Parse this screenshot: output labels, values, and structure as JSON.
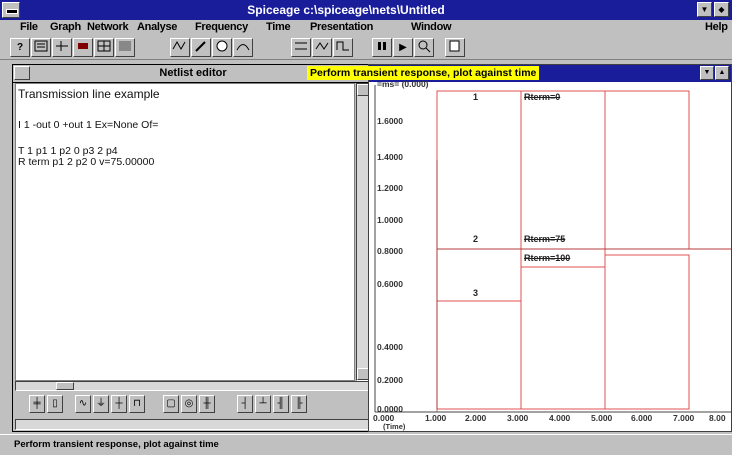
{
  "window": {
    "title": "Spiceage c:\\spiceage\\nets\\Untitled",
    "minimize_glyph": "▼",
    "restore_glyph": "◆"
  },
  "menu": {
    "items": [
      "File",
      "Graph",
      "Network",
      "Analyse",
      "Frequency",
      "Time",
      "Presentation",
      "Window"
    ],
    "help": "Help"
  },
  "toolbar": {
    "buttons": [
      "help-icon",
      "netlist-icon",
      "network-icon",
      "component-icon",
      "grid-icon",
      "table-icon",
      "wave-icon",
      "probe-icon",
      "circle-icon",
      "graph-icon",
      "compare-icon",
      "time-icon",
      "step-icon",
      "run-icon",
      "zoom-icon",
      "export-icon"
    ],
    "help_label": "?",
    "run_label": "▶"
  },
  "netlist": {
    "title": "Netlist editor",
    "lines": [
      "Transmission line example",
      "I  1          -out 0       +out 1      Ex=None    Of=",
      "T  1          p1 1         p2 0        p3 2         p4",
      "R  term       p1 2         p2 0        v=75.00000"
    ],
    "components": [
      "cap-icon",
      "resistor-icon",
      "inductor-icon",
      "ground-icon",
      "diode-icon",
      "source-icon",
      "switch-icon",
      "meter-icon",
      "tline-icon",
      "coupler-icon",
      "probe-icon",
      "port-icon"
    ]
  },
  "plot": {
    "title": "Perform transient response, plot against time",
    "header_label": "=ms= (0.000)",
    "y_ticks": [
      "1.6000",
      "1.4000",
      "1.2000",
      "1.0000",
      "0.8000",
      "0.6000",
      "0.4000",
      "0.2000",
      "0.0000"
    ],
    "x_ticks": [
      "0.000",
      "1.000",
      "2.000",
      "3.000",
      "4.000",
      "5.000",
      "6.000",
      "7.000",
      "8.00"
    ],
    "x_unit": "(Time)",
    "segments": [
      "1",
      "2",
      "3"
    ],
    "annotations": [
      "Rterm=0",
      "Rterm=75",
      "Rterm=100"
    ]
  },
  "statusbar": {
    "text": "Perform transient response, plot against time"
  },
  "colors": {
    "title_bar": "#1a1d9a",
    "highlight": "#ffff00",
    "plot_line": "#e05050",
    "grid_line": "#8b2a2a"
  }
}
